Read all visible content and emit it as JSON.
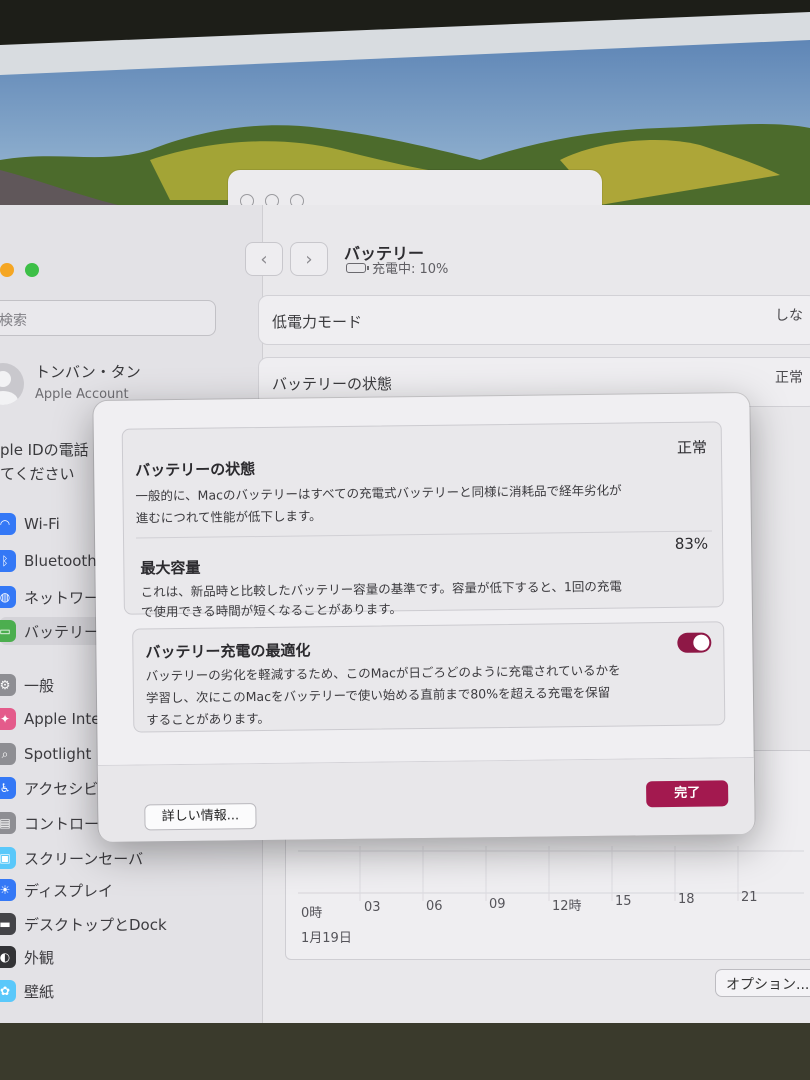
{
  "sidebar": {
    "search_placeholder": "検索",
    "account_name": "トンバン・タン",
    "account_sub": "Apple Account",
    "appleid_notice_line1": "ple IDの電話",
    "appleid_notice_line2": "てください",
    "items": [
      {
        "label": "Wi-Fi",
        "icon": "wifi-icon",
        "color": "#3478f6"
      },
      {
        "label": "Bluetooth",
        "icon": "bluetooth-icon",
        "color": "#3478f6"
      },
      {
        "label": "ネットワーク",
        "icon": "network-icon",
        "color": "#3478f6"
      },
      {
        "label": "バッテリー",
        "icon": "battery-icon",
        "color": "#4cae4f"
      },
      {
        "label": "一般",
        "icon": "gear-icon",
        "color": "#8e8e93"
      },
      {
        "label": "Apple Intell",
        "icon": "apple-intelligence-icon",
        "color": "#e45b8b"
      },
      {
        "label": "Spotlight",
        "icon": "spotlight-icon",
        "color": "#8e8e93"
      },
      {
        "label": "アクセシビリ",
        "icon": "accessibility-icon",
        "color": "#3478f6"
      },
      {
        "label": "コントロール",
        "icon": "control-center-icon",
        "color": "#8e8e93"
      },
      {
        "label": "スクリーンセーバ",
        "icon": "screensaver-icon",
        "color": "#5ac8fa"
      },
      {
        "label": "ディスプレイ",
        "icon": "display-icon",
        "color": "#3478f6"
      },
      {
        "label": "デスクトップとDock",
        "icon": "dock-icon",
        "color": "#444448"
      },
      {
        "label": "外観",
        "icon": "appearance-icon",
        "color": "#333336"
      },
      {
        "label": "壁紙",
        "icon": "wallpaper-icon",
        "color": "#5ac8fa"
      }
    ]
  },
  "pane": {
    "title": "バッテリー",
    "subtitle": "充電中: 10%",
    "rows": [
      {
        "label": "低電力モード",
        "value": "しな"
      },
      {
        "label": "バッテリーの状態",
        "value": "正常"
      }
    ],
    "chart_ticks": [
      "0時",
      "03",
      "06",
      "09",
      "12時",
      "15",
      "18",
      "21"
    ],
    "chart_date": "1月19日",
    "options_label": "オプション..."
  },
  "dialog": {
    "health": {
      "title": "バッテリーの状態",
      "value": "正常",
      "desc_line1": "一般的に、Macのバッテリーはすべての充電式バッテリーと同様に消耗品で経年劣化が",
      "desc_line2": "進むにつれて性能が低下します。"
    },
    "capacity": {
      "title": "最大容量",
      "value": "83%",
      "desc_line1": "これは、新品時と比較したバッテリー容量の基準です。容量が低下すると、1回の充電",
      "desc_line2": "で使用できる時間が短くなることがあります。"
    },
    "optimize": {
      "title": "バッテリー充電の最適化",
      "enabled": true,
      "desc_line1": "バッテリーの劣化を軽減するため、このMacが日ごろどのように充電されているかを",
      "desc_line2": "学習し、次にこのMacをバッテリーで使い始める直前まで80%を超える充電を保留",
      "desc_line3": "することがあります。"
    },
    "more_info_label": "詳しい情報...",
    "done_label": "完了",
    "accent": "#a3194f"
  }
}
